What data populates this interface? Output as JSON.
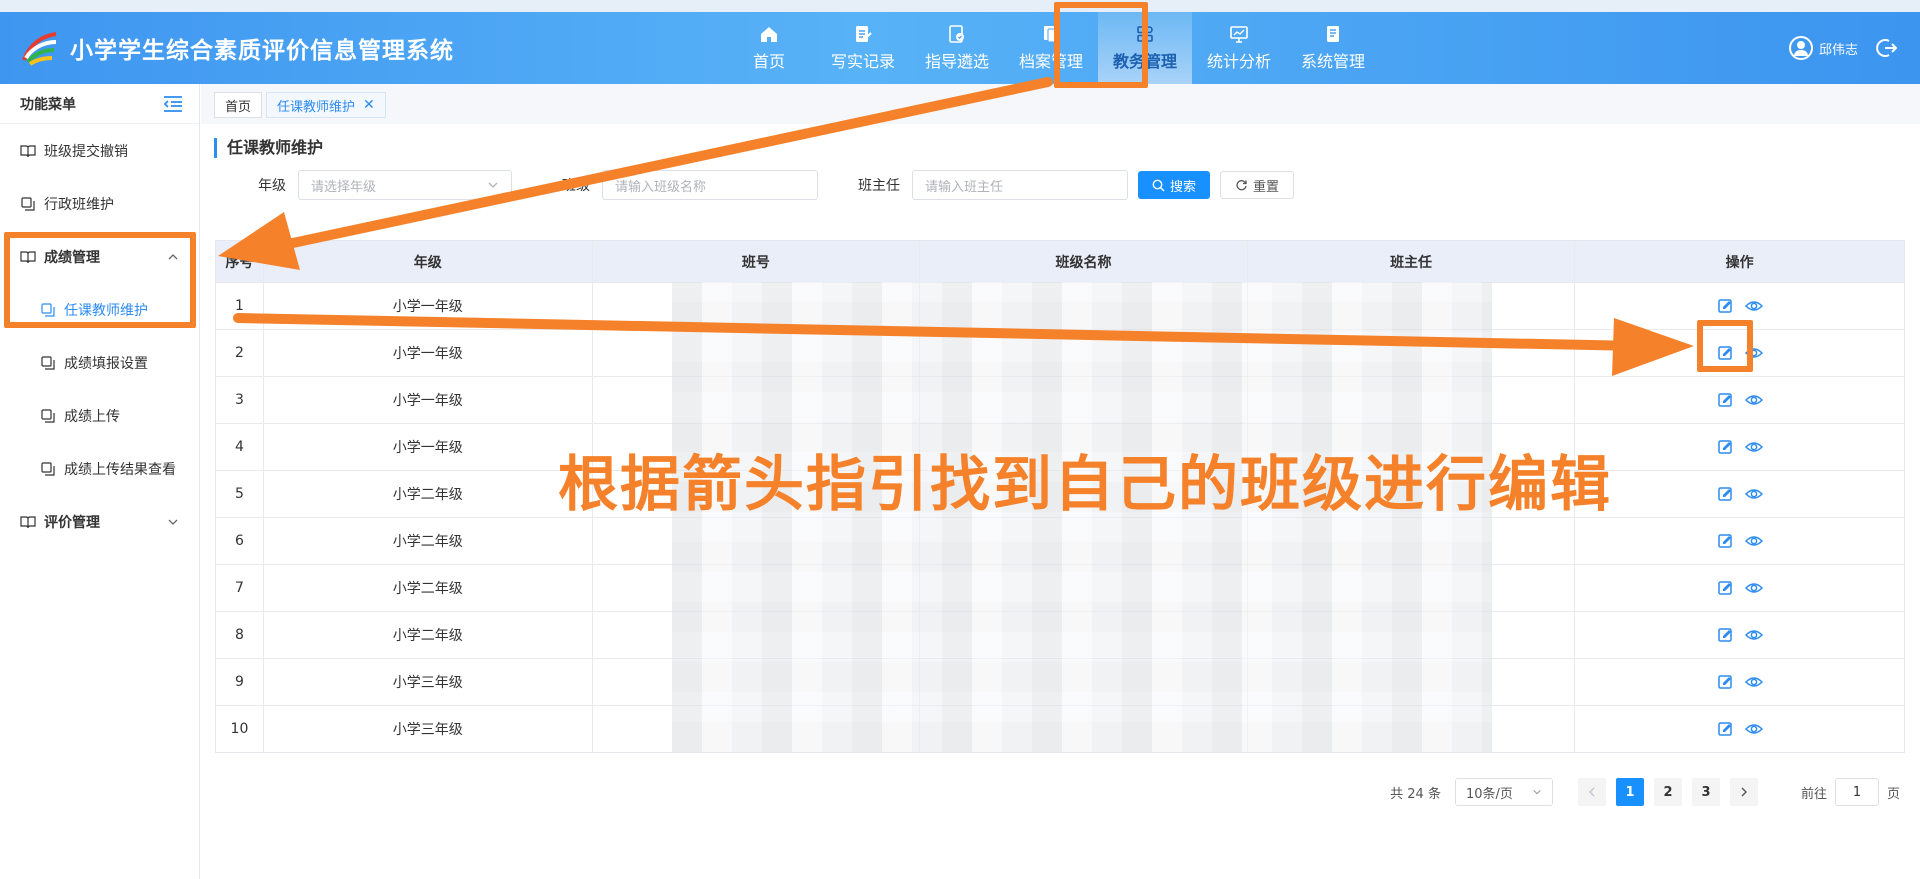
{
  "app": {
    "title": "小学学生综合素质评价信息管理系统"
  },
  "nav": [
    {
      "label": "首页",
      "icon": "home-icon"
    },
    {
      "label": "写实记录",
      "icon": "record-icon"
    },
    {
      "label": "指导遴选",
      "icon": "guide-icon"
    },
    {
      "label": "档案管理",
      "icon": "archive-icon"
    },
    {
      "label": "教务管理",
      "icon": "grid-icon",
      "active": true
    },
    {
      "label": "统计分析",
      "icon": "chart-icon"
    },
    {
      "label": "系统管理",
      "icon": "settings-icon"
    }
  ],
  "user": {
    "name": "邱伟志"
  },
  "sidebar": {
    "title": "功能菜单",
    "items": [
      {
        "label": "班级提交撤销"
      },
      {
        "label": "行政班维护"
      },
      {
        "label": "成绩管理"
      },
      {
        "label": "任课教师维护"
      },
      {
        "label": "成绩填报设置"
      },
      {
        "label": "成绩上传"
      },
      {
        "label": "成绩上传结果查看"
      },
      {
        "label": "评价管理"
      }
    ]
  },
  "tabs": [
    {
      "label": "首页"
    },
    {
      "label": "任课教师维护"
    }
  ],
  "page": {
    "title": "任课教师维护"
  },
  "filters": {
    "grade_label": "年级",
    "grade_placeholder": "请选择年级",
    "class_label": "班级",
    "class_placeholder": "请输入班级名称",
    "teacher_label": "班主任",
    "teacher_placeholder": "请输入班主任",
    "search_label": "搜索",
    "reset_label": "重置"
  },
  "table": {
    "headers": [
      "序号",
      "年级",
      "班号",
      "班级名称",
      "班主任",
      "操作"
    ],
    "rows": [
      {
        "no": "1",
        "grade": "小学一年级"
      },
      {
        "no": "2",
        "grade": "小学一年级"
      },
      {
        "no": "3",
        "grade": "小学一年级"
      },
      {
        "no": "4",
        "grade": "小学一年级"
      },
      {
        "no": "5",
        "grade": "小学二年级"
      },
      {
        "no": "6",
        "grade": "小学二年级"
      },
      {
        "no": "7",
        "grade": "小学二年级"
      },
      {
        "no": "8",
        "grade": "小学二年级"
      },
      {
        "no": "9",
        "grade": "小学三年级"
      },
      {
        "no": "10",
        "grade": "小学三年级"
      }
    ]
  },
  "pagination": {
    "total": "共 24 条",
    "page_size": "10条/页",
    "pages": [
      "1",
      "2",
      "3"
    ],
    "current": 1,
    "goto_prefix": "前往",
    "goto_value": "1",
    "goto_suffix": "页"
  },
  "annotation": {
    "text": "根据箭头指引找到自己的班级进行编辑",
    "color": "#f5822a"
  },
  "colors": {
    "primary": "#1890ff",
    "header": "#4aa3f3",
    "annotation": "#f5822a"
  }
}
